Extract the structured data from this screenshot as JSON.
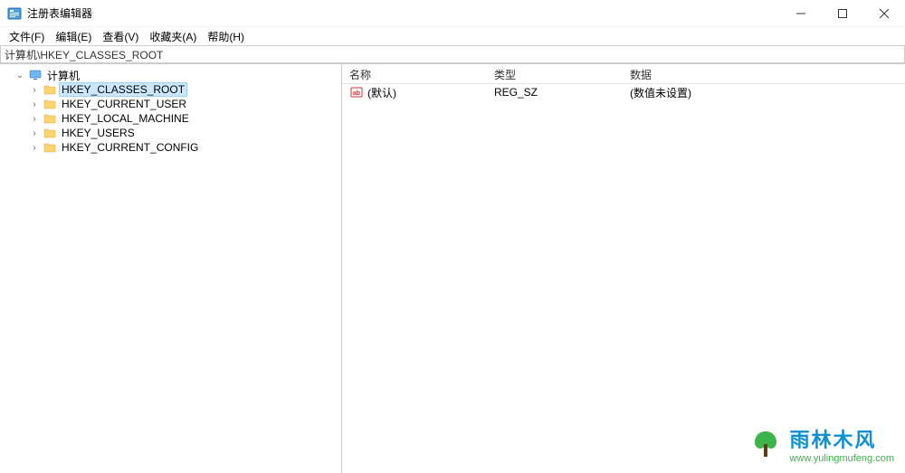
{
  "window": {
    "title": "注册表编辑器"
  },
  "menu": {
    "file": "文件(F)",
    "edit": "编辑(E)",
    "view": "查看(V)",
    "favorites": "收藏夹(A)",
    "help": "帮助(H)"
  },
  "address": "计算机\\HKEY_CLASSES_ROOT",
  "tree": {
    "root": "计算机",
    "hives": [
      "HKEY_CLASSES_ROOT",
      "HKEY_CURRENT_USER",
      "HKEY_LOCAL_MACHINE",
      "HKEY_USERS",
      "HKEY_CURRENT_CONFIG"
    ]
  },
  "list": {
    "headers": {
      "name": "名称",
      "type": "类型",
      "data": "数据"
    },
    "rows": [
      {
        "name": "(默认)",
        "type": "REG_SZ",
        "data": "(数值未设置)"
      }
    ]
  },
  "watermark": {
    "brand": "雨林木风",
    "url": "www.yulingmufeng.com"
  }
}
